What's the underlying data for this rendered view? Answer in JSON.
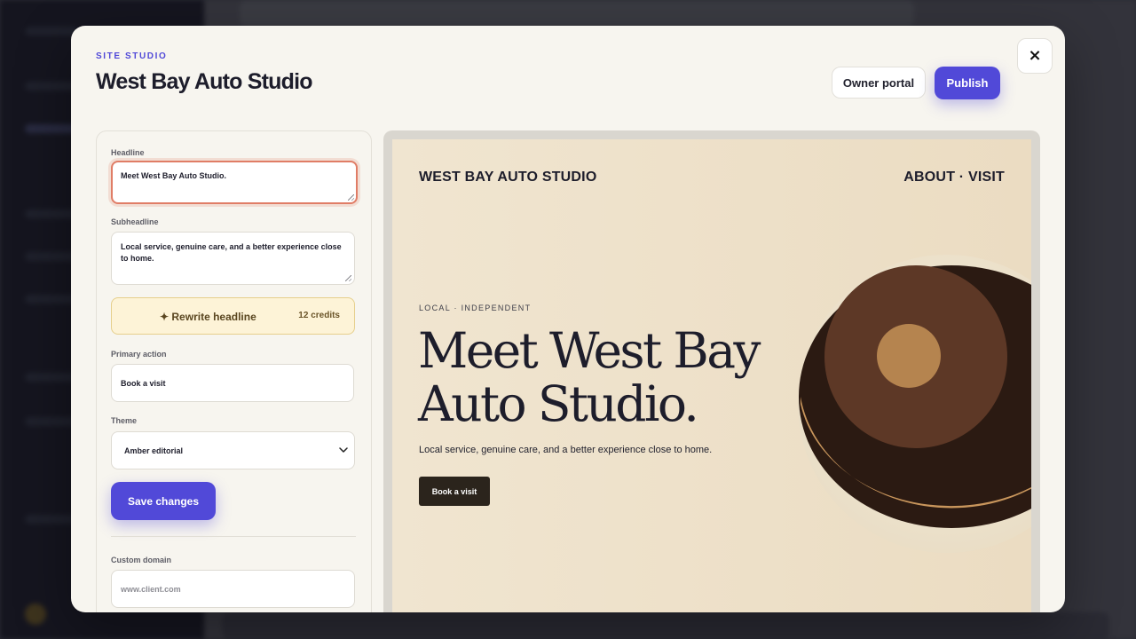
{
  "modal": {
    "eyebrow": "SITE STUDIO",
    "title": "West Bay Auto Studio",
    "owner_portal_label": "Owner portal",
    "publish_label": "Publish",
    "close_label": "×"
  },
  "editor": {
    "headline_label": "Headline",
    "headline_value": "Meet West Bay Auto Studio.",
    "subheadline_label": "Subheadline",
    "subheadline_value": "Local service, genuine care, and a better experience close to home.",
    "rewrite_label": "✦ Rewrite headline",
    "rewrite_credits": "12 credits",
    "primary_action_label": "Primary action",
    "primary_action_value": "Book a visit",
    "theme_label": "Theme",
    "theme_value": "Amber editorial",
    "save_label": "Save changes",
    "domain_label": "Custom domain",
    "domain_placeholder": "www.client.com"
  },
  "preview": {
    "brand": "WEST BAY AUTO STUDIO",
    "nav": "ABOUT · VISIT",
    "eyebrow": "LOCAL · INDEPENDENT",
    "headline": "Meet West Bay Auto Studio.",
    "subheadline": "Local service, genuine care, and a better experience close to home.",
    "cta": "Book a visit"
  },
  "colors": {
    "accent": "#5149d8",
    "focus_ring": "#e07d66",
    "preview_bg": "#efe3cd",
    "cta_bg": "#2b241c"
  }
}
